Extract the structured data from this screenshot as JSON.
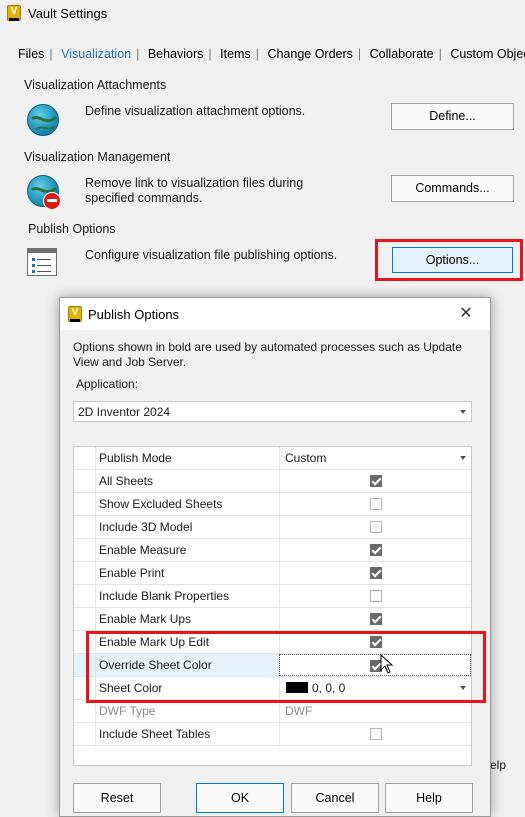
{
  "window": {
    "title": "Vault Settings",
    "app_icon_letter": "V"
  },
  "tabs": [
    "Files",
    "Visualization",
    "Behaviors",
    "Items",
    "Change Orders",
    "Collaborate",
    "Custom Objects"
  ],
  "active_tab": "Visualization",
  "sections": {
    "attachments": {
      "title": "Visualization Attachments",
      "description": "Define visualization attachment options.",
      "button": "Define..."
    },
    "management": {
      "title": "Visualization Management",
      "description": "Remove link to visualization files during specified commands.",
      "button": "Commands..."
    },
    "publish": {
      "title": "Publish Options",
      "description": "Configure visualization file publishing options.",
      "button": "Options..."
    }
  },
  "behind_help_text": "elp",
  "dialog": {
    "title": "Publish Options",
    "close_glyph": "✕",
    "info": "Options shown in bold are used by automated processes such as Update View and Job Server.",
    "application_label": "Application:",
    "application_value": "2D Inventor 2024",
    "rows": [
      {
        "label": "Publish Mode",
        "type": "dropdown",
        "value": "Custom"
      },
      {
        "label": "All Sheets",
        "type": "checkbox",
        "checked": true,
        "enabled": true
      },
      {
        "label": "Show Excluded Sheets",
        "type": "checkbox",
        "checked": false,
        "enabled": true
      },
      {
        "label": "Include 3D Model",
        "type": "checkbox",
        "checked": false,
        "enabled": true
      },
      {
        "label": "Enable Measure",
        "type": "checkbox",
        "checked": true,
        "enabled": true
      },
      {
        "label": "Enable Print",
        "type": "checkbox",
        "checked": true,
        "enabled": true
      },
      {
        "label": "Include Blank Properties",
        "type": "checkbox",
        "checked": false,
        "enabled": true
      },
      {
        "label": "Enable Mark Ups",
        "type": "checkbox",
        "checked": true,
        "enabled": true
      },
      {
        "label": "Enable Mark Up Edit",
        "type": "checkbox",
        "checked": true,
        "enabled": true
      },
      {
        "label": "Override Sheet Color",
        "type": "checkbox",
        "checked": true,
        "enabled": true,
        "selected": true
      },
      {
        "label": "Sheet Color",
        "type": "color",
        "value": "0, 0, 0",
        "color": "#000000"
      },
      {
        "label": "DWF Type",
        "type": "text",
        "value": "DWF"
      },
      {
        "label": "Include Sheet Tables",
        "type": "checkbox",
        "checked": false,
        "enabled": true
      }
    ],
    "buttons": {
      "reset": "Reset",
      "ok": "OK",
      "cancel": "Cancel",
      "help": "Help"
    }
  },
  "colors": {
    "accent_tab": "#1e73be",
    "highlight_red": "#e8141a",
    "selected_row": "#e5f1fb"
  }
}
